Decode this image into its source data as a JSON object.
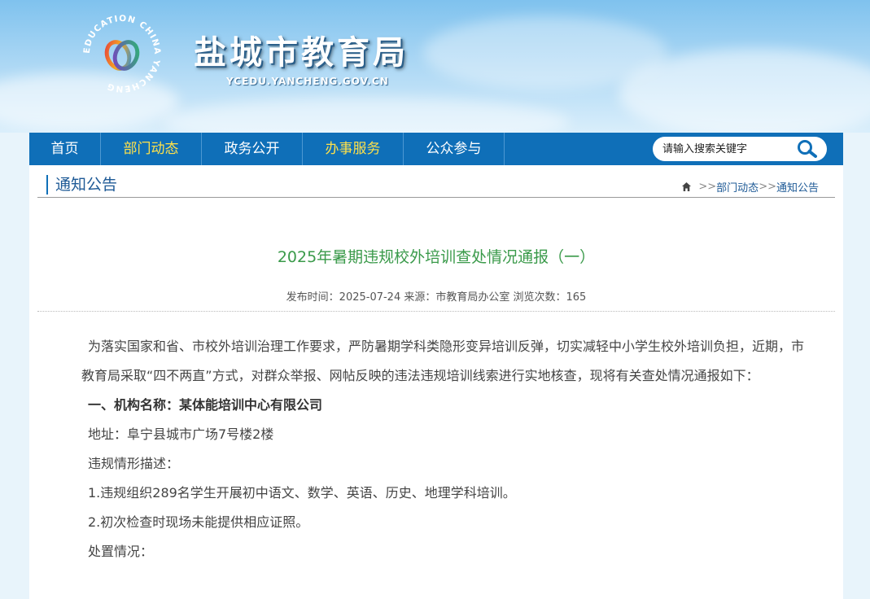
{
  "header": {
    "logo_ring_text": "EDUCATION CHINA YANCHENG",
    "title": "盐城市教育局",
    "url": "YCEDU.YANCHENG.GOV.CN"
  },
  "nav": {
    "items": [
      {
        "label": "首页"
      },
      {
        "label": "部门动态"
      },
      {
        "label": "政务公开"
      },
      {
        "label": "办事服务"
      },
      {
        "label": "公众参与"
      }
    ],
    "search": {
      "placeholder": "请输入搜索关键字",
      "icon": "search-icon"
    }
  },
  "section": {
    "title": "通知公告",
    "breadcrumb": {
      "home_icon": "home-icon",
      "sep": ">>",
      "items": [
        "部门动态",
        "通知公告"
      ]
    }
  },
  "article": {
    "title": "2025年暑期违规校外培训查处情况通报（一）",
    "meta": "发布时间：2025-07-24 来源：市教育局办公室 浏览次数：165",
    "intro": "为落实国家和省、市校外培训治理工作要求，严防暑期学科类隐形变异培训反弹，切实减轻中小学生校外培训负担，近期，市教育局采取“四不两直”方式，对群众举报、网帖反映的违法违规培训线索进行实地核查，现将有关查处情况通报如下：",
    "org_heading": "一、机构名称：某体能培训中心有限公司",
    "address": "地址：阜宁县城市广场7号楼2楼",
    "violation_heading": "违规情形描述：",
    "violation_1": "1.违规组织289名学生开展初中语文、数学、英语、历史、地理学科培训。",
    "violation_2": "2.初次检查时现场未能提供相应证照。",
    "handling_heading": "处置情况："
  },
  "colors": {
    "nav_bg": "#0f6fb8",
    "nav_highlight": "#ffe14a",
    "title_green": "#3a9a4a",
    "link_blue": "#1e5a96"
  }
}
